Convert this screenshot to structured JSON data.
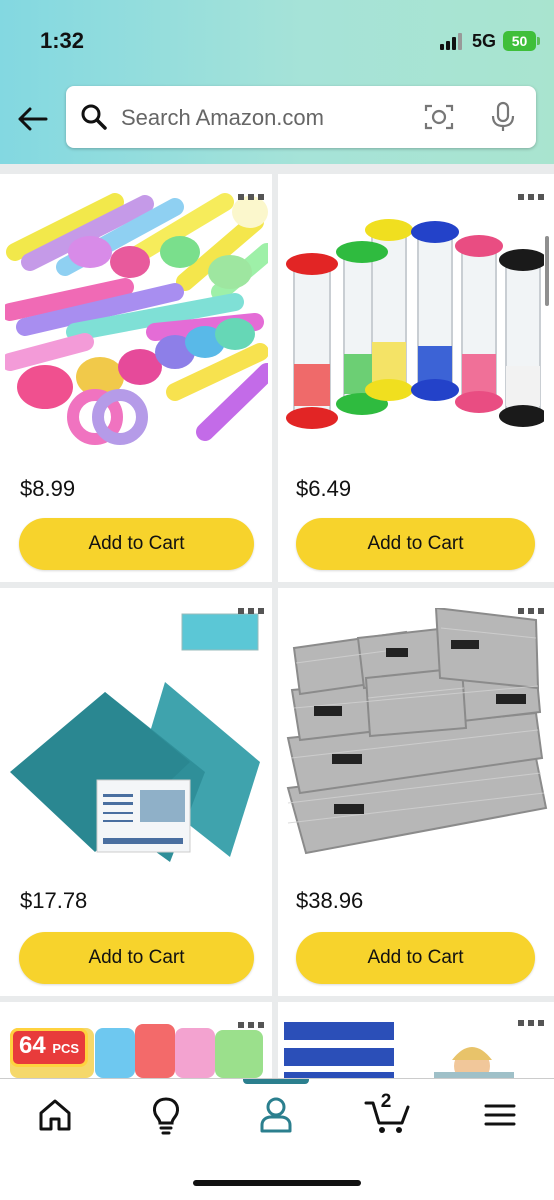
{
  "status_bar": {
    "time": "1:32",
    "network": "5G",
    "battery": "50"
  },
  "search": {
    "placeholder": "Search Amazon.com"
  },
  "products": [
    {
      "image": "colorful-stretchy-unicorn-toys",
      "price": "$8.99",
      "button": "Add to Cart"
    },
    {
      "image": "sand-timers-set",
      "price": "$6.49",
      "button": "Add to Cart"
    },
    {
      "image": "teal-fluorescent-light-filters",
      "price": "$17.78",
      "button": "Add to Cart"
    },
    {
      "image": "gray-woven-storage-baskets",
      "price": "$38.96",
      "button": "Add to Cart"
    },
    {
      "image": "pop-it-fidget-toys",
      "badge": "64",
      "badge_unit": "PCS"
    },
    {
      "image": "blue-headbands-child"
    }
  ],
  "tabbar": {
    "items": [
      "home-icon",
      "lightbulb-icon",
      "profile-icon",
      "cart-icon",
      "menu-icon"
    ],
    "cart_count": "2",
    "active": "profile"
  },
  "colors": {
    "accent": "#2b7f8e",
    "button": "#f7d32c",
    "header_from": "#83d8e1",
    "header_to": "#a9e4cf"
  }
}
